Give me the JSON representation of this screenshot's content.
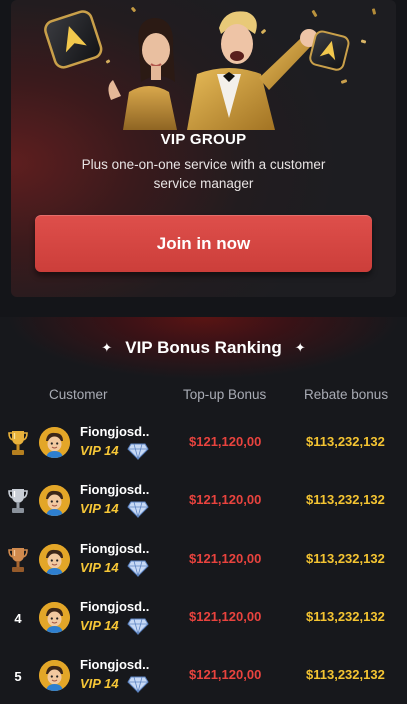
{
  "vip_group": {
    "title": "VIP GROUP",
    "description": "Plus one-on-one service with a customer service manager",
    "join_button": "Join in now"
  },
  "ranking": {
    "title": "VIP Bonus Ranking",
    "columns": {
      "customer": "Customer",
      "topup": "Top-up Bonus",
      "rebate": "Rebate bonus"
    },
    "rows": [
      {
        "rank": "",
        "medal": "gold-trophy-icon",
        "name": "Fiongjosd..",
        "vip": "VIP 14",
        "topup": "$121,120,00",
        "rebate": "$113,232,132"
      },
      {
        "rank": "",
        "medal": "silver-trophy-icon",
        "name": "Fiongjosd..",
        "vip": "VIP 14",
        "topup": "$121,120,00",
        "rebate": "$113,232,132"
      },
      {
        "rank": "",
        "medal": "bronze-trophy-icon",
        "name": "Fiongjosd..",
        "vip": "VIP 14",
        "topup": "$121,120,00",
        "rebate": "$113,232,132"
      },
      {
        "rank": "4",
        "medal": "",
        "name": "Fiongjosd..",
        "vip": "VIP 14",
        "topup": "$121,120,00",
        "rebate": "$113,232,132"
      },
      {
        "rank": "5",
        "medal": "",
        "name": "Fiongjosd..",
        "vip": "VIP 14",
        "topup": "$121,120,00",
        "rebate": "$113,232,132"
      }
    ]
  },
  "colors": {
    "accent_red": "#d9463f",
    "topup_red": "#e8433e",
    "rebate_gold": "#f4c432",
    "vip_gold": "#f7c737",
    "background": "#141519"
  }
}
